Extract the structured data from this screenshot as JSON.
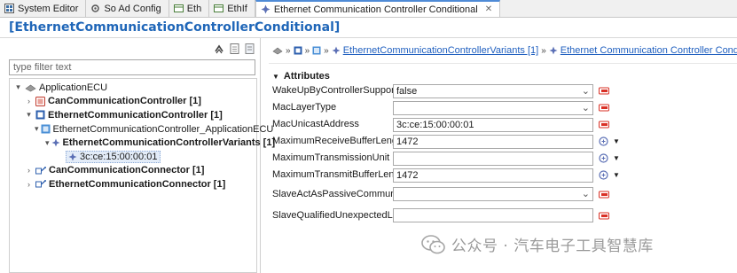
{
  "tabs": [
    {
      "label": "System Editor",
      "icon": "grid-icon",
      "active": false
    },
    {
      "label": "So Ad Config",
      "icon": "gear-icon",
      "active": false
    },
    {
      "label": "Eth",
      "icon": "table-icon",
      "active": false
    },
    {
      "label": "EthIf",
      "icon": "table-icon",
      "active": false
    },
    {
      "label": "Ethernet Communication Controller Conditional",
      "icon": "diamond-icon",
      "active": true,
      "close": "✕"
    }
  ],
  "editor": {
    "title": "[EthernetCommunicationControllerConditional]"
  },
  "filter": {
    "placeholder": "type filter text"
  },
  "tree": [
    {
      "label": "ApplicationECU",
      "suffix": "",
      "indent": 0,
      "twisty": "▾",
      "icon": "ecu-icon",
      "bold": false
    },
    {
      "label": "CanCommunicationController",
      "suffix": " [1]",
      "indent": 1,
      "twisty": "›",
      "icon": "can-controller-icon",
      "bold": true
    },
    {
      "label": "EthernetCommunicationController",
      "suffix": " [1]",
      "indent": 1,
      "twisty": "▾",
      "icon": "eth-controller-icon",
      "bold": true
    },
    {
      "label": "EthernetCommunicationController_ApplicationECU",
      "suffix": "",
      "indent": 2,
      "twisty": "▾",
      "icon": "eth-instance-icon",
      "bold": false
    },
    {
      "label": "EthernetCommunicationControllerVariants",
      "suffix": " [1]",
      "indent": 3,
      "twisty": "▾",
      "icon": "variant-icon",
      "bold": true
    },
    {
      "label": "3c:ce:15:00:00:01",
      "suffix": "",
      "indent": 4,
      "twisty": "",
      "icon": "variant-icon",
      "bold": false,
      "selected": true
    },
    {
      "label": "CanCommunicationConnector",
      "suffix": " [1]",
      "indent": 1,
      "twisty": "›",
      "icon": "connector-icon",
      "bold": true
    },
    {
      "label": "EthernetCommunicationConnector",
      "suffix": " [1]",
      "indent": 1,
      "twisty": "›",
      "icon": "connector-icon",
      "bold": true
    }
  ],
  "breadcrumb": {
    "link1": "EthernetCommunicationControllerVariants [1]",
    "link2": "Ethernet Communication Controller Conditional"
  },
  "attributes": {
    "section_title": "Attributes",
    "rows": [
      {
        "label": "WakeUpByControllerSupported",
        "value": "false",
        "kind": "combo",
        "trailing": "clear"
      },
      {
        "label": "MacLayerType",
        "value": "",
        "kind": "combo",
        "trailing": "clear"
      },
      {
        "label": "MacUnicastAddress",
        "value": "3c:ce:15:00:00:01",
        "kind": "text",
        "trailing": "clear"
      },
      {
        "label": "MaximumReceiveBufferLength",
        "value": "1472",
        "kind": "text",
        "trailing": "ref"
      },
      {
        "label": "MaximumTransmissionUnit",
        "value": "",
        "kind": "text",
        "trailing": "ref"
      },
      {
        "label": "MaximumTransmitBufferLength",
        "value": "1472",
        "kind": "text",
        "trailing": "ref"
      },
      {
        "label": "SlaveActAsPassiveCommunicatio...",
        "value": "",
        "kind": "combo",
        "trailing": "clear",
        "tall": true
      },
      {
        "label": "SlaveQualifiedUnexpectedLinkD...",
        "value": "",
        "kind": "text",
        "trailing": "clear",
        "tall": true
      }
    ]
  },
  "watermark": {
    "text": "公众号 · 汽车电子工具智慧库"
  },
  "colors": {
    "accent": "#1f66b8",
    "link": "#1f5fbf",
    "clear_red": "#d93025"
  }
}
